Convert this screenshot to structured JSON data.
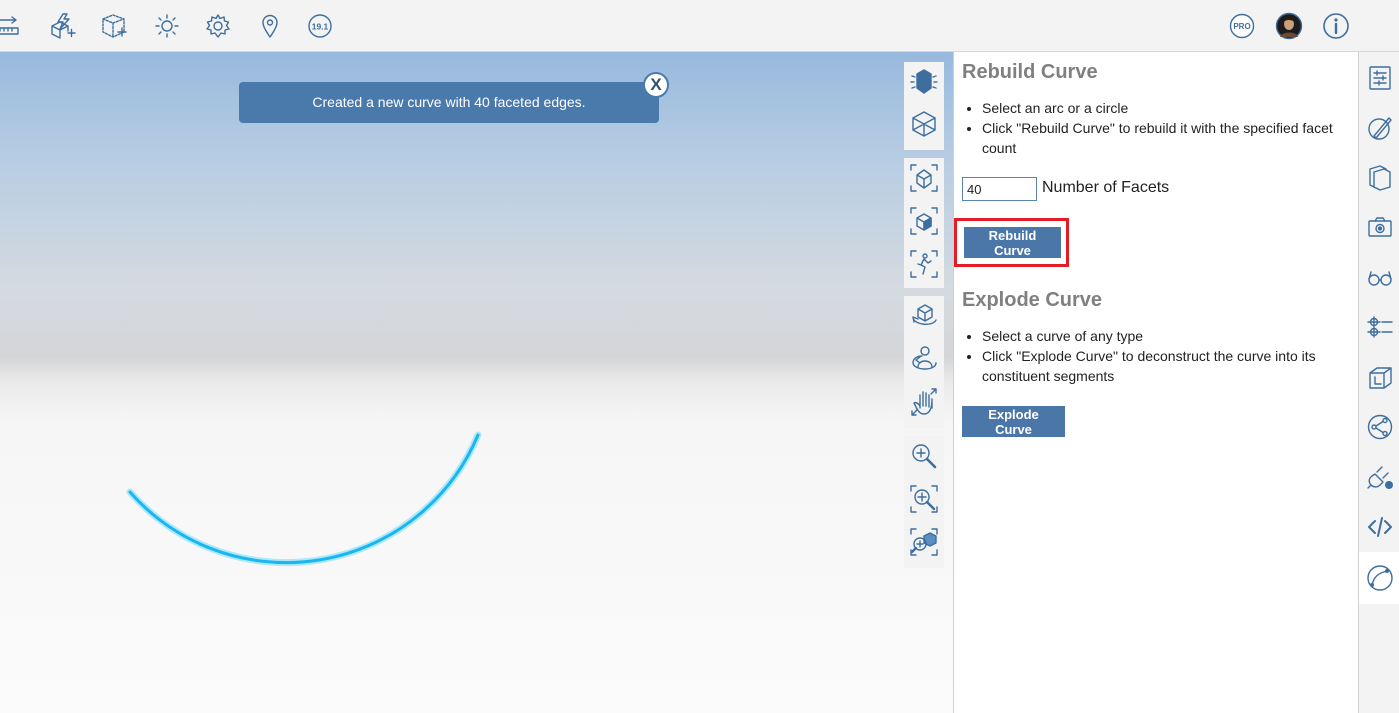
{
  "toast": {
    "message": "Created a new curve with 40 faceted edges.",
    "close_label": "X"
  },
  "toolbar": {
    "version_badge": "19.1",
    "pro_badge": "PRO"
  },
  "panel": {
    "rebuild": {
      "title": "Rebuild Curve",
      "instructions": [
        "Select an arc or a circle",
        "Click \"Rebuild Curve\" to rebuild it with the specified facet count"
      ],
      "facets_value": "40",
      "facets_label": "Number of Facets",
      "button_label": "Rebuild Curve"
    },
    "explode": {
      "title": "Explode Curve",
      "instructions": [
        "Select a curve of any type",
        "Click \"Explode Curve\" to deconstruct the curve into its constituent segments"
      ],
      "button_label": "Explode Curve"
    }
  },
  "colors": {
    "accent": "#4a76a8",
    "highlight": "#e31c25",
    "curve": "#1ab6f0"
  }
}
